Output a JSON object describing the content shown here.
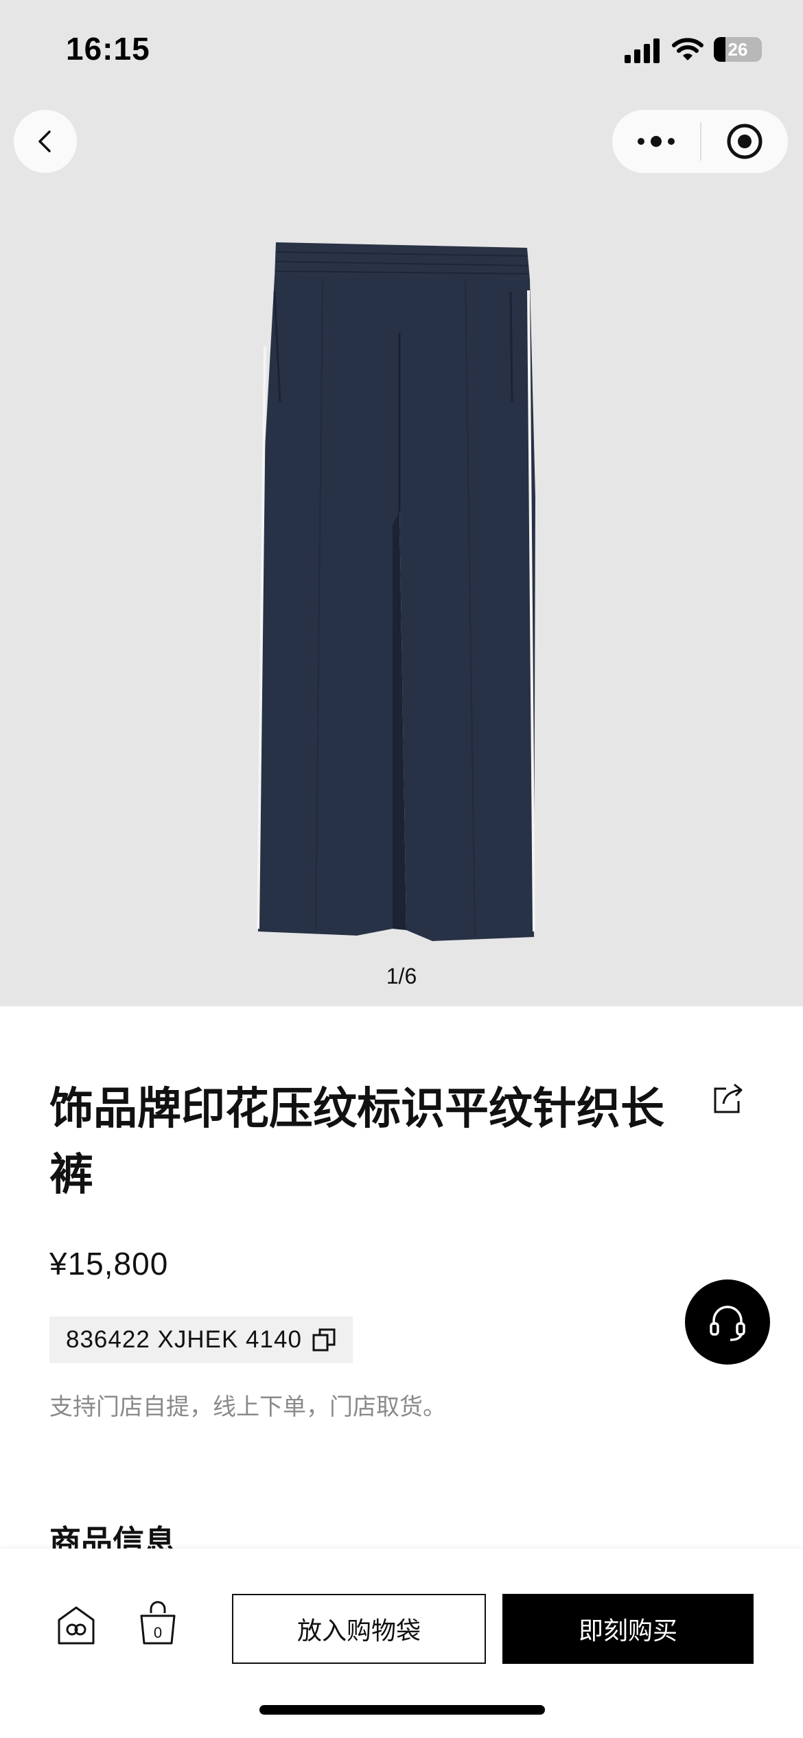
{
  "status_bar": {
    "time": "16:15",
    "battery": "26"
  },
  "gallery": {
    "pager": "1/6"
  },
  "product": {
    "title": "饰品牌印花压纹标识平纹针织长裤",
    "price": "¥15,800",
    "sku": "836422 XJHEK 4140",
    "pickup_note": "支持门店自提，线上下单，门店取货。",
    "section_title": "商品信息"
  },
  "actions": {
    "add_to_bag": "放入购物袋",
    "buy_now": "即刻购买",
    "bag_count": "0"
  },
  "colors": {
    "accent": "#000000",
    "hero_bg": "#e6e6e6",
    "note_gray": "#8a8a8a",
    "pants_navy": "#283246"
  }
}
